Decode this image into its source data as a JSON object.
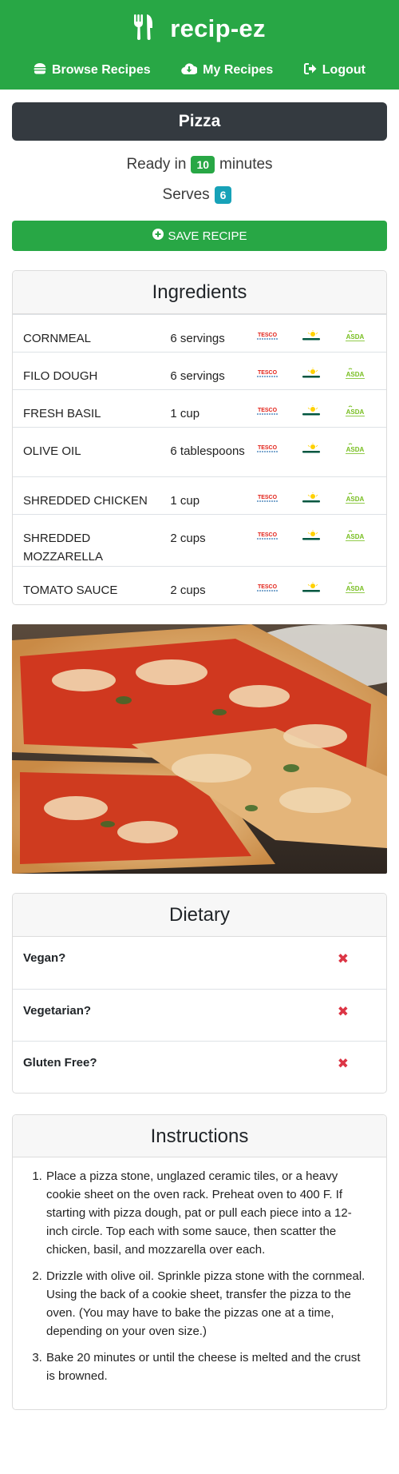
{
  "brand": {
    "name": "recip-ez",
    "icon": "utensils-icon"
  },
  "nav": {
    "browse": {
      "label": "Browse Recipes",
      "icon": "hamburger-icon"
    },
    "my": {
      "label": "My Recipes",
      "icon": "cloud-download-icon"
    },
    "logout": {
      "label": "Logout",
      "icon": "sign-out-icon"
    }
  },
  "recipe": {
    "title": "Pizza",
    "ready_prefix": "Ready in",
    "ready_minutes": "10",
    "ready_suffix": "minutes",
    "serves_label": "Serves",
    "serves_count": "6",
    "save_label": "SAVE RECIPE"
  },
  "ingredients": {
    "header": "Ingredients",
    "stores": [
      "TESCO",
      "Morrisons",
      "ASDA"
    ],
    "items": [
      {
        "name": "CORNMEAL",
        "amount": "6 servings"
      },
      {
        "name": "FILO DOUGH",
        "amount": "6 servings"
      },
      {
        "name": "FRESH BASIL",
        "amount": "1 cup"
      },
      {
        "name": "OLIVE OIL",
        "amount": "6 tablespoons"
      },
      {
        "name": "SHREDDED CHICKEN",
        "amount": "1 cup"
      },
      {
        "name": "SHREDDED MOZZARELLA",
        "amount": "2 cups"
      },
      {
        "name": "TOMATO SAUCE",
        "amount": "2 cups"
      }
    ]
  },
  "dietary": {
    "header": "Dietary",
    "items": [
      {
        "label": "Vegan?",
        "value": "✖"
      },
      {
        "label": "Vegetarian?",
        "value": "✖"
      },
      {
        "label": "Gluten Free?",
        "value": "✖"
      }
    ]
  },
  "instructions": {
    "header": "Instructions",
    "steps": [
      "Place a pizza stone, unglazed ceramic tiles, or a heavy cookie sheet on the oven rack. Preheat oven to 400 F. If starting with pizza dough, pat or pull each piece into a 12-inch circle. Top each with some sauce, then scatter the chicken, basil, and mozzarella over each.",
      "Drizzle with olive oil. Sprinkle pizza stone with the cornmeal. Using the back of a cookie sheet, transfer the pizza to the oven. (You may have to bake the pizzas one at a time, depending on your oven size.)",
      "Bake 20 minutes or until the cheese is melted and the crust is browned."
    ]
  },
  "colors": {
    "primary_green": "#28a745",
    "dark_title": "#343a40",
    "info_blue": "#17a2b8",
    "danger_red": "#dc3545",
    "tesco_red": "#e2231a",
    "tesco_blue": "#00539f",
    "morrisons_green": "#00563f",
    "morrisons_yellow": "#ffd100",
    "asda_green": "#78be20"
  }
}
